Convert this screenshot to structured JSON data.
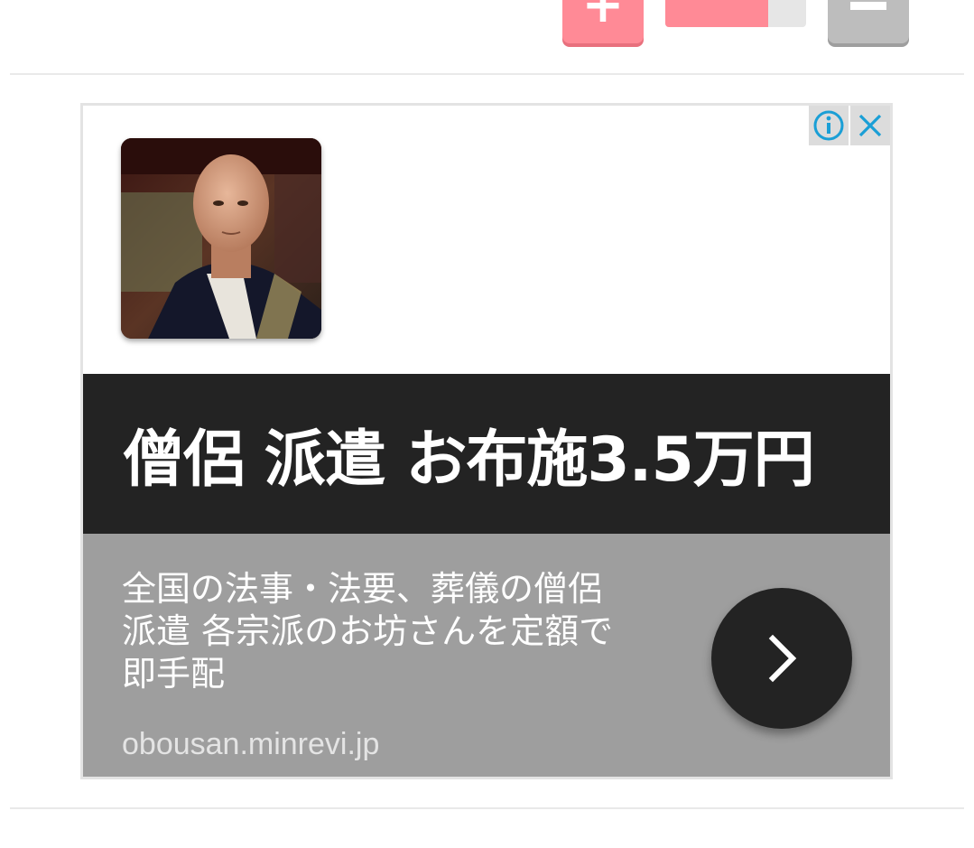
{
  "controls": {
    "plus_icon": "plus-icon",
    "minus_icon": "minus-icon",
    "progress_fraction": 0.73,
    "accent_color": "#ff8a96",
    "disabled_color": "#bdbdbd"
  },
  "ad": {
    "info_icon": "info-icon",
    "close_icon": "close-icon",
    "image": "monk-portrait",
    "headline": "僧侶 派遣 お布施3.5万円",
    "description_lines": [
      "全国の法事・法要、葬儀の僧侶",
      "派遣 各宗派のお坊さんを定額で",
      "即手配"
    ],
    "domain": "obousan.minrevi.jp",
    "cta_icon": "chevron-right-icon",
    "colors": {
      "headline_bg": "#232323",
      "description_bg": "#9e9e9e",
      "icon_accent": "#1a9fd6"
    }
  }
}
